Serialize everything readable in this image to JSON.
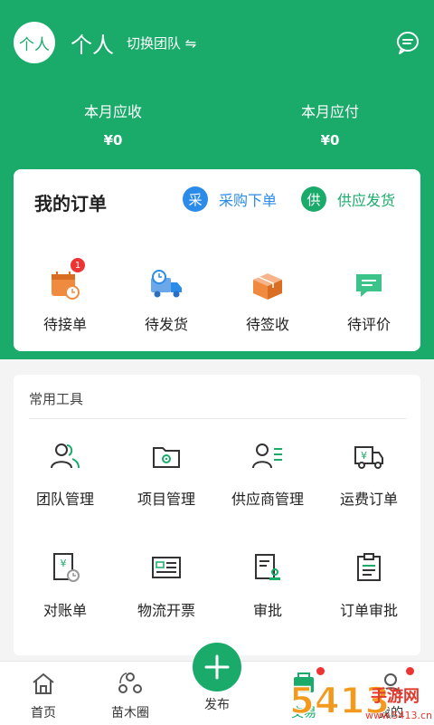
{
  "header": {
    "avatar_text": "个人",
    "team_name": "个人",
    "switch_team_label": "切换团队 ⇋"
  },
  "stats": {
    "receivable_label": "本月应收",
    "receivable_value": "¥0",
    "payable_label": "本月应付",
    "payable_value": "¥0"
  },
  "orders": {
    "title": "我的订单",
    "purchase_icon_text": "采",
    "purchase_label": "采购下单",
    "supply_icon_text": "供",
    "supply_label": "供应发货",
    "items": [
      {
        "label": "待接单",
        "icon": "calendar-clock-icon",
        "badge": "1"
      },
      {
        "label": "待发货",
        "icon": "delivery-truck-icon"
      },
      {
        "label": "待签收",
        "icon": "package-box-icon"
      },
      {
        "label": "待评价",
        "icon": "comment-icon"
      }
    ]
  },
  "tools": {
    "title": "常用工具",
    "items": [
      {
        "label": "团队管理",
        "icon": "team-icon"
      },
      {
        "label": "项目管理",
        "icon": "project-folder-icon"
      },
      {
        "label": "供应商管理",
        "icon": "supplier-icon"
      },
      {
        "label": "运费订单",
        "icon": "freight-truck-icon"
      },
      {
        "label": "对账单",
        "icon": "statement-icon"
      },
      {
        "label": "物流开票",
        "icon": "invoice-icon"
      },
      {
        "label": "审批",
        "icon": "approval-stamp-icon"
      },
      {
        "label": "订单审批",
        "icon": "clipboard-icon"
      }
    ]
  },
  "tabbar": {
    "items": [
      {
        "label": "首页",
        "icon": "home-icon"
      },
      {
        "label": "苗木圈",
        "icon": "nursery-circle-icon"
      },
      {
        "label": "发布",
        "icon": "plus-icon"
      },
      {
        "label": "交易",
        "icon": "trade-icon"
      },
      {
        "label": "我的",
        "icon": "profile-icon"
      }
    ]
  },
  "watermark": {
    "brand_number": "5413",
    "brand_text": "手游网",
    "domain": "www.5413.cn"
  },
  "colors": {
    "brand_green": "#1aab6b",
    "blue_accent": "#2a8be8",
    "badge_red": "#e33333",
    "orange_icon": "#f08a3e"
  }
}
